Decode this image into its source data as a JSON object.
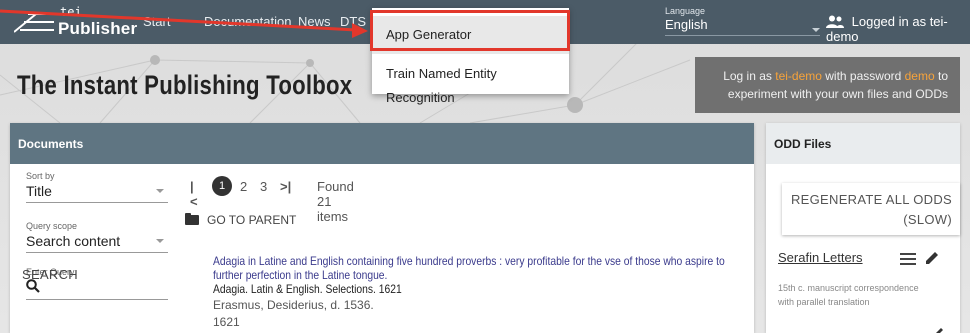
{
  "app": {
    "logo_top": "tei",
    "logo_bottom": "Publisher"
  },
  "nav": {
    "start": "Start",
    "documentation": "Documentation",
    "news": "News",
    "dts": "DTS"
  },
  "dropdown": {
    "items": [
      "App Generator",
      "Train Named Entity Recognition"
    ]
  },
  "language": {
    "label": "Language",
    "value": "English"
  },
  "user": {
    "status": "Logged in as tei-demo"
  },
  "page": {
    "title": "The Instant Publishing Toolbox"
  },
  "login_hint": {
    "line1_prefix": "Log in as ",
    "user": "tei-demo",
    "line1_mid": " with password ",
    "password": "demo",
    "line1_suffix": " to",
    "line2": "experiment with your own files and ODDs"
  },
  "documents": {
    "header": "Documents",
    "sort": {
      "label": "Sort by",
      "value": "Title"
    },
    "scope": {
      "label": "Query scope",
      "value": "Search content"
    },
    "query": {
      "label": "Enter Query"
    },
    "search_button": "SEARCH",
    "pagination": {
      "first": "|<",
      "pages": [
        "1",
        "2",
        "3"
      ],
      "last": ">|",
      "found": "Found 21 items"
    },
    "parent_label": "GO TO PARENT",
    "items": [
      {
        "title_line1": "Adagia in Latine and English containing five hundred proverbs : very profitable for the vse of those who aspire to",
        "title_line2": "further perfection in the Latine tongue.",
        "subtitle": "Adagia. Latin & English. Selections. 1621",
        "author": "Erasmus, Desiderius, d. 1536.",
        "year": "1621"
      }
    ]
  },
  "odd": {
    "header": "ODD Files",
    "regenerate_line1": "REGENERATE ALL ODDS",
    "regenerate_line2": "(SLOW)",
    "files": [
      {
        "name": "Serafin Letters",
        "description_line1": "15th c. manuscript correspondence",
        "description_line2": "with parallel translation"
      }
    ]
  },
  "colors": {
    "topbar": "#4b5b67",
    "panel_header": "#5f7582",
    "highlight": "#e2372b",
    "accent": "#f7a33a",
    "link": "#3a3a8c"
  }
}
